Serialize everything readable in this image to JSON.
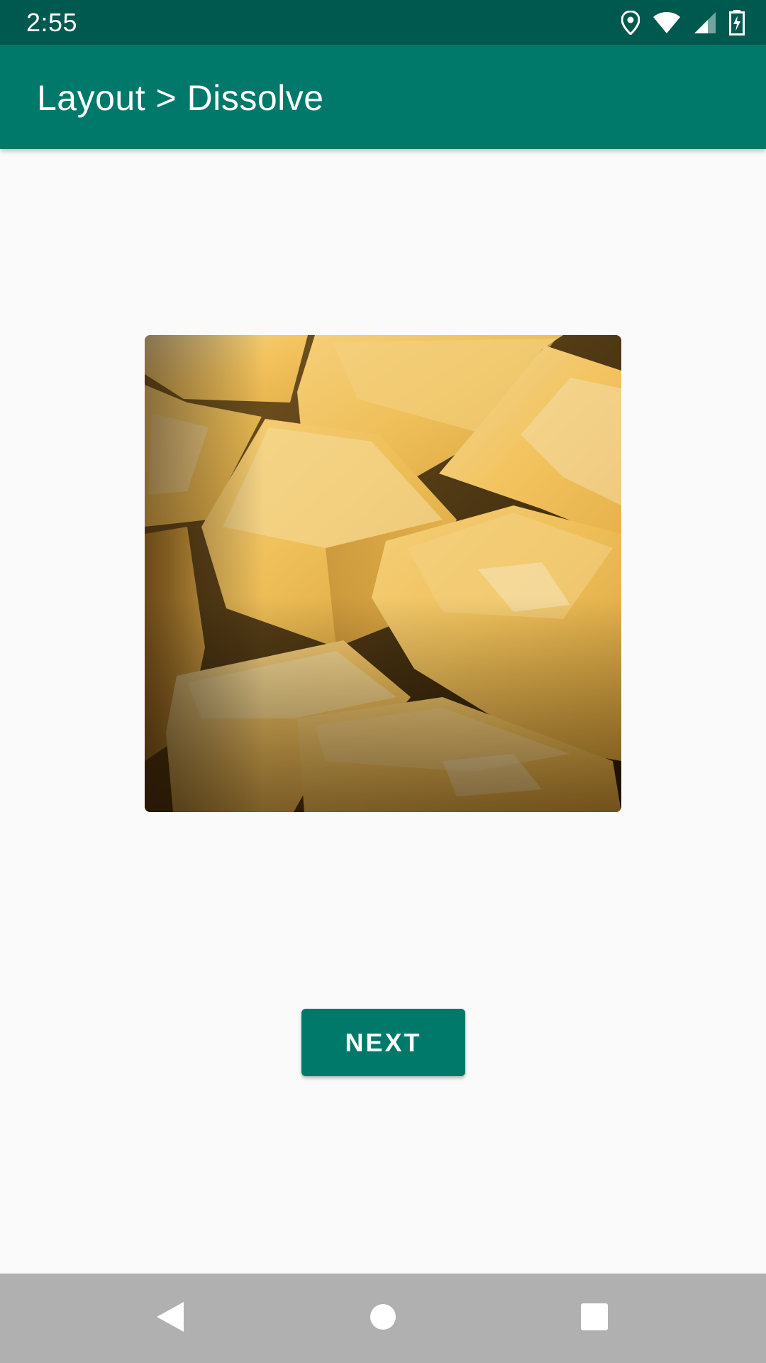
{
  "status_bar": {
    "time": "2:55",
    "icons": [
      "location-icon",
      "wifi-icon",
      "cell-signal-icon",
      "battery-charging-icon"
    ],
    "background": "#00594f"
  },
  "app_bar": {
    "title": "Layout > Dissolve",
    "background": "#00796b"
  },
  "content": {
    "image": "cheese-cubes-photo",
    "next_label": "NEXT",
    "button_color": "#00796b"
  },
  "nav_bar": {
    "icons": [
      "back-icon",
      "home-icon",
      "recents-icon"
    ]
  }
}
